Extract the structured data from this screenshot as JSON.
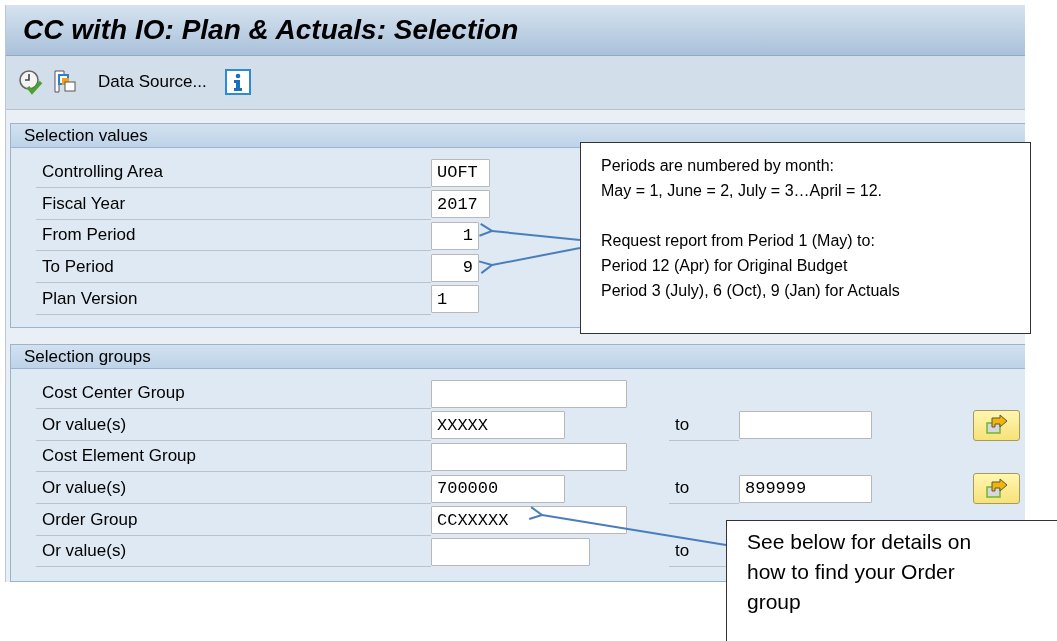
{
  "window": {
    "title": "CC with IO: Plan & Actuals: Selection"
  },
  "toolbar": {
    "data_source": "Data Source..."
  },
  "selection_values": {
    "title": "Selection values",
    "rows": [
      {
        "label": "Controlling Area",
        "kind": "code",
        "value": "UOFT"
      },
      {
        "label": "Fiscal Year",
        "kind": "code",
        "value": "2017"
      },
      {
        "label": "From Period",
        "kind": "period",
        "value": "1"
      },
      {
        "label": "To Period",
        "kind": "period",
        "value": "9"
      },
      {
        "label": "Plan Version",
        "kind": "version",
        "value": "1"
      }
    ]
  },
  "selection_groups": {
    "title": "Selection groups",
    "rows": [
      {
        "label": "Cost Center Group",
        "kind": "group"
      },
      {
        "label": "Or value(s)",
        "kind": "range",
        "value": "XXXXX",
        "to_label": "to"
      },
      {
        "label": "Cost Element Group",
        "kind": "group"
      },
      {
        "label": "Or value(s)",
        "kind": "range",
        "value": "700000",
        "to_label": "to",
        "to_value": "899999"
      },
      {
        "label": "Order Group",
        "kind": "group",
        "value": "CCXXXXX"
      },
      {
        "label": "Or value(s)",
        "kind": "range_wide",
        "to_label": "to"
      }
    ]
  },
  "callouts": [
    {
      "paragraphs": [
        "Periods are numbered by month:\nMay = 1, June = 2, July = 3…April = 12.",
        "Request report from Period 1 (May) to:\nPeriod 12 (Apr) for Original Budget\nPeriod 3 (July), 6 (Oct), 9 (Jan) for Actuals"
      ]
    },
    {
      "paragraphs": [
        "See below for details on\nhow to find your Order\ngroup"
      ]
    }
  ]
}
